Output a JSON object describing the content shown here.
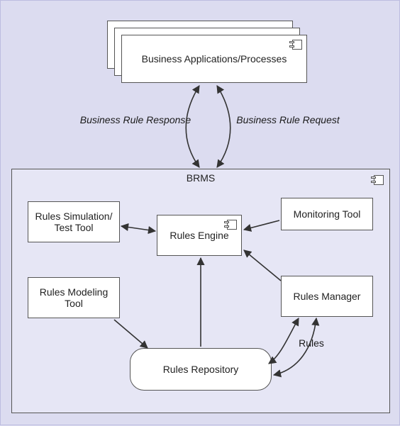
{
  "system_title": "BRMS",
  "business_apps": {
    "label": "Business Applications/Processes"
  },
  "edges": {
    "response": "Business Rule Response",
    "request": "Business Rule Request",
    "rules": "Rules"
  },
  "components": {
    "rules_engine": "Rules Engine",
    "rules_sim_test": "Rules Simulation/\nTest Tool",
    "monitoring_tool": "Monitoring Tool",
    "rules_modeling": "Rules Modeling Tool",
    "rules_manager": "Rules Manager",
    "rules_repository": "Rules Repository"
  }
}
